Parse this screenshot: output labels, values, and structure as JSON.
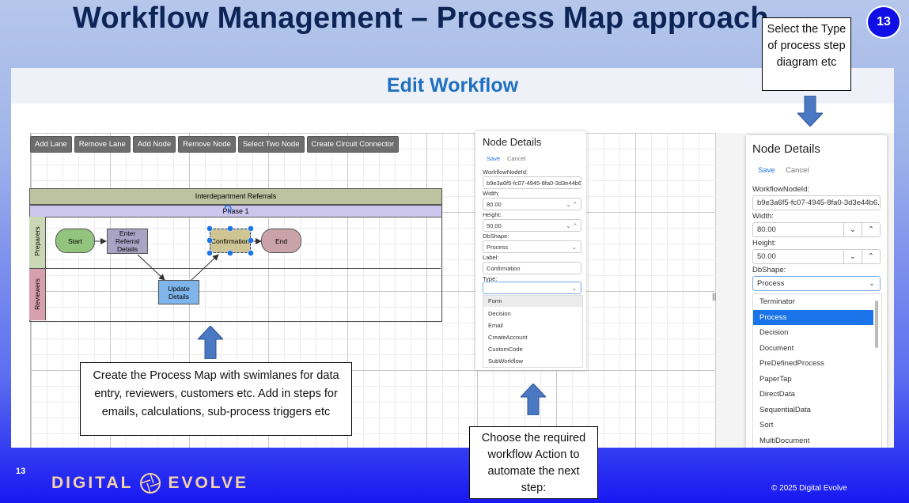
{
  "slide": {
    "title": "Workflow Management – Process Map approach",
    "page_number": "13",
    "footer_page": "13",
    "logo_text_left": "DIGITAL",
    "logo_text_right": "EVOLVE",
    "copyright": "© 2025 Digital Evolve"
  },
  "app": {
    "header_title": "Edit Workflow"
  },
  "toolbar": {
    "buttons": [
      "Add Lane",
      "Remove Lane",
      "Add Node",
      "Remove Node",
      "Select Two Node",
      "Create Circuit Connector"
    ]
  },
  "diagram": {
    "pool_title": "Interdepartment Referrals",
    "phase_label": "Phase 1",
    "lanes": [
      "Preparers",
      "Reviewers"
    ],
    "nodes": {
      "start": "Start",
      "enter": "Enter Referral Details",
      "confirmation": "Confirmation",
      "end": "End",
      "update": "Update Details"
    }
  },
  "panel_small": {
    "title": "Node Details",
    "save": "Save",
    "cancel": "Cancel",
    "id_label": "WorkflowNodeId:",
    "id_value": "b9e3a6f5-fc07-4945-8fa0-3d3e44b6...",
    "width_label": "Width:",
    "width_value": "80.00",
    "height_label": "Height:",
    "height_value": "50.00",
    "shape_label": "DbShape:",
    "shape_value": "Process",
    "label_label": "Label:",
    "label_value": "Confirmation",
    "type_label": "Type:",
    "type_value": "",
    "type_options": [
      "Form",
      "Decision",
      "Email",
      "CreateAccount",
      "CustomCode",
      "SubWorkflow"
    ]
  },
  "panel_large": {
    "title": "Node Details",
    "save": "Save",
    "cancel": "Cancel",
    "id_label": "WorkflowNodeId:",
    "id_value": "b9e3a6f5-fc07-4945-8fa0-3d3e44b6...",
    "width_label": "Width:",
    "width_value": "80.00",
    "height_label": "Height:",
    "height_value": "50.00",
    "shape_label": "DbShape:",
    "shape_value": "Process",
    "shape_options": [
      "Terminator",
      "Process",
      "Decision",
      "Document",
      "PreDefinedProcess",
      "PaperTap",
      "DirectData",
      "SequentialData",
      "Sort",
      "MultiDocument"
    ],
    "selected_option": "Process"
  },
  "callouts": {
    "left": "Create the Process Map with swimlanes for data entry, reviewers, customers etc.  Add in steps for emails, calculations, sub-process triggers etc",
    "middle": "Choose the required workflow Action to automate the next step:",
    "right": "Select the Type of process step diagram etc"
  },
  "colors": {
    "title": "#0d2457",
    "header_text": "#1f6fc0",
    "selected_option": "#1a73e8",
    "arrow": "#4a78c2"
  }
}
